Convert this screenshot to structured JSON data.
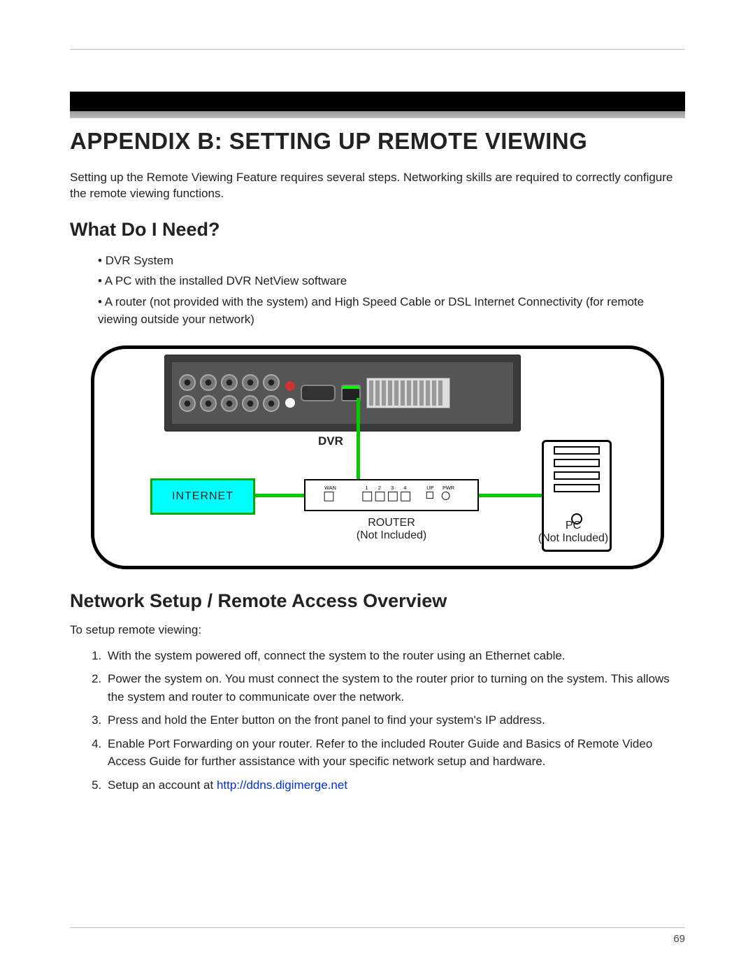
{
  "title": "APPENDIX B: SETTING UP REMOTE VIEWING",
  "intro": "Setting up the Remote Viewing Feature requires several steps. Networking skills are required to correctly configure the remote viewing functions.",
  "section1": {
    "heading": "What Do I Need?",
    "items": [
      "DVR System",
      "A PC with the installed DVR NetView software",
      "A router (not provided with the system) and High Speed Cable or DSL Internet Connectivity (for remote viewing outside your network)"
    ]
  },
  "diagram": {
    "dvr_label": "DVR",
    "internet_label": "INTERNET",
    "router_label": "ROUTER",
    "router_note": "(Not Included)",
    "router_ports": {
      "wan": "WAN",
      "p1": "1",
      "p2": "2",
      "p3": "3",
      "p4": "4",
      "up": "UP",
      "pwr": "PWR"
    },
    "pc_label": "PC",
    "pc_note": "(Not Included)"
  },
  "section2": {
    "heading": "Network Setup / Remote Access Overview",
    "lead": "To setup remote viewing:",
    "steps": [
      "With the system powered off, connect the system to the router using an Ethernet cable.",
      "Power the system on. You must connect the system to the router prior to turning on the system. This allows the system and router to communicate over the network.",
      "Press and hold the Enter button on the front panel to find your system's IP address.",
      "Enable Port Forwarding on your router. Refer to the included Router Guide and Basics of Remote Video Access Guide for further assistance with your specific network setup and hardware."
    ],
    "step5_prefix": "Setup an account at ",
    "step5_link": "http://ddns.digimerge.net"
  },
  "page_number": "69"
}
